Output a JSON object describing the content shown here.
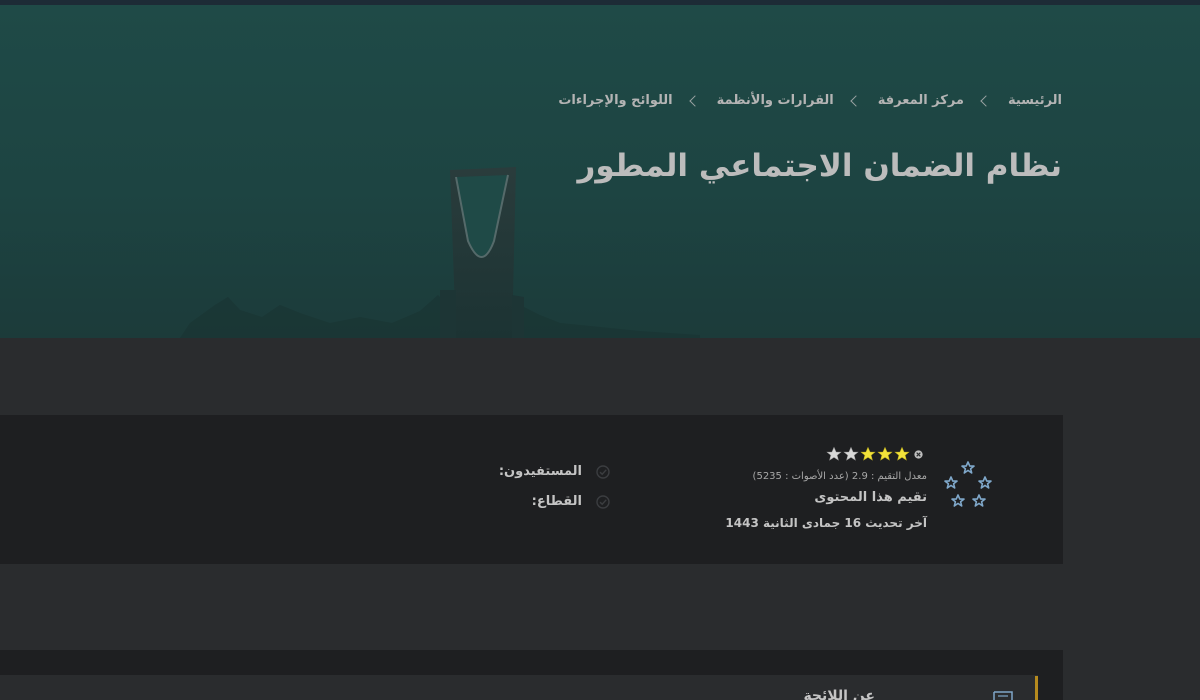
{
  "breadcrumb": {
    "items": [
      "الرئيسية",
      "مركز المعرفة",
      "القرارات والأنظمة",
      "اللوائح والإجراءات"
    ]
  },
  "page": {
    "title": "نظام الضمان الاجتماعي المطور"
  },
  "rating": {
    "stars_filled": 3,
    "stars_total": 5,
    "meta": "معدل التقيم : 2.9 (عدد الأصوات : 5235)",
    "rate_label": "تقيم هذا المحتوى",
    "last_update": "آخر تحديث 16 جمادى الثانية 1443"
  },
  "fields": {
    "beneficiaries": "المستفيدون:",
    "sector": "القطاع:"
  },
  "bottom": {
    "partial_title": "عن اللائحة"
  },
  "colors": {
    "star_filled": "#f2e23a",
    "star_empty": "#d8d8d8",
    "accent": "#b58a1e",
    "hero_bg": "#1f4a47"
  },
  "icons": {
    "emblem": "stars-ring-icon",
    "clear": "clear-rating-icon",
    "check": "check-circle-icon",
    "document": "document-icon",
    "separator": "chevron-left-icon"
  }
}
